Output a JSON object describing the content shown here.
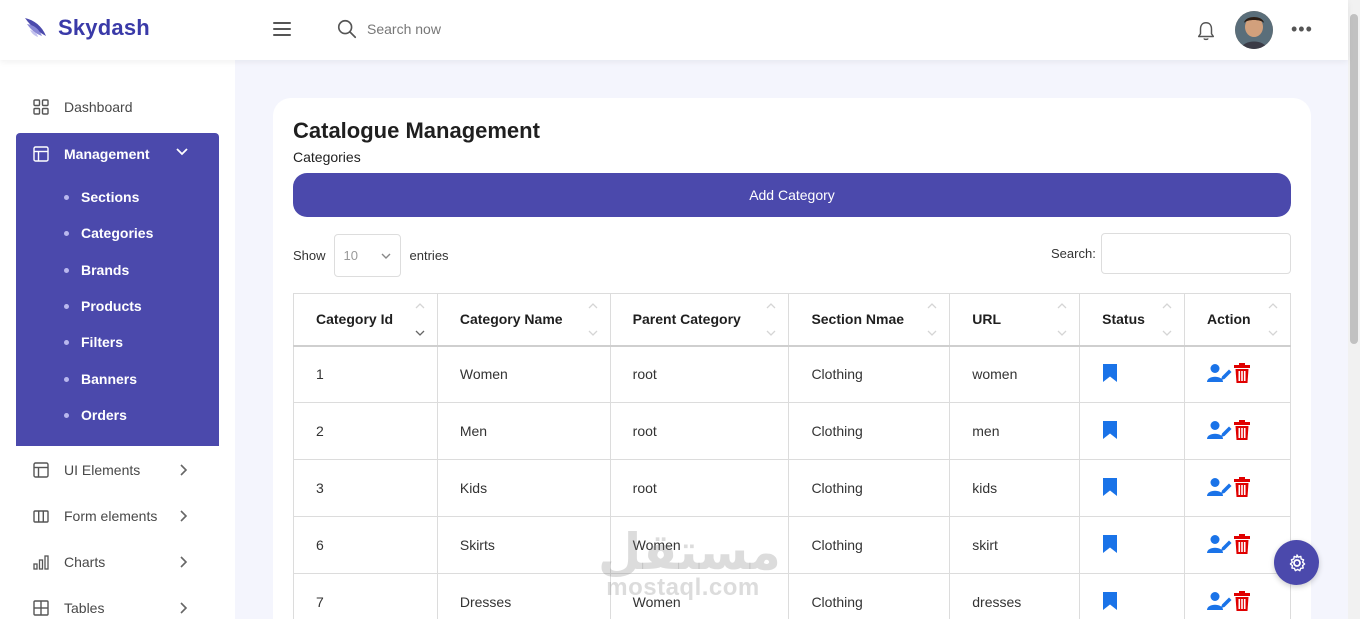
{
  "app": {
    "brand": "Skydash",
    "search_placeholder": "Search now",
    "more_label": "•••"
  },
  "colors": {
    "primary": "#4b49ac",
    "status_blue": "#1a73e8",
    "edit_blue": "#1a73e8",
    "delete_red": "#e00000"
  },
  "sidebar": {
    "dashboard": "Dashboard",
    "management": "Management",
    "submenu": [
      "Sections",
      "Categories",
      "Brands",
      "Products",
      "Filters",
      "Banners",
      "Orders"
    ],
    "ui_elements": "UI Elements",
    "form_elements": "Form elements",
    "charts": "Charts",
    "tables": "Tables"
  },
  "page": {
    "title": "Catalogue Management",
    "subtitle": "Categories",
    "add_button": "Add Category",
    "show_label": "Show",
    "page_length": "10",
    "entries_label": "entries",
    "search_label": "Search:"
  },
  "table": {
    "headers": [
      "Category Id",
      "Category Name",
      "Parent Category",
      "Section Nmae",
      "URL",
      "Status",
      "Action"
    ],
    "rows": [
      {
        "id": "1",
        "name": "Women",
        "parent": "root",
        "section": "Clothing",
        "url": "women"
      },
      {
        "id": "2",
        "name": "Men",
        "parent": "root",
        "section": "Clothing",
        "url": "men"
      },
      {
        "id": "3",
        "name": "Kids",
        "parent": "root",
        "section": "Clothing",
        "url": "kids"
      },
      {
        "id": "6",
        "name": "Skirts",
        "parent": "Women",
        "section": "Clothing",
        "url": "skirt"
      },
      {
        "id": "7",
        "name": "Dresses",
        "parent": "Women",
        "section": "Clothing",
        "url": "dresses"
      }
    ]
  },
  "watermark": {
    "arabic": "مستقل",
    "latin": "mostaql.com"
  }
}
